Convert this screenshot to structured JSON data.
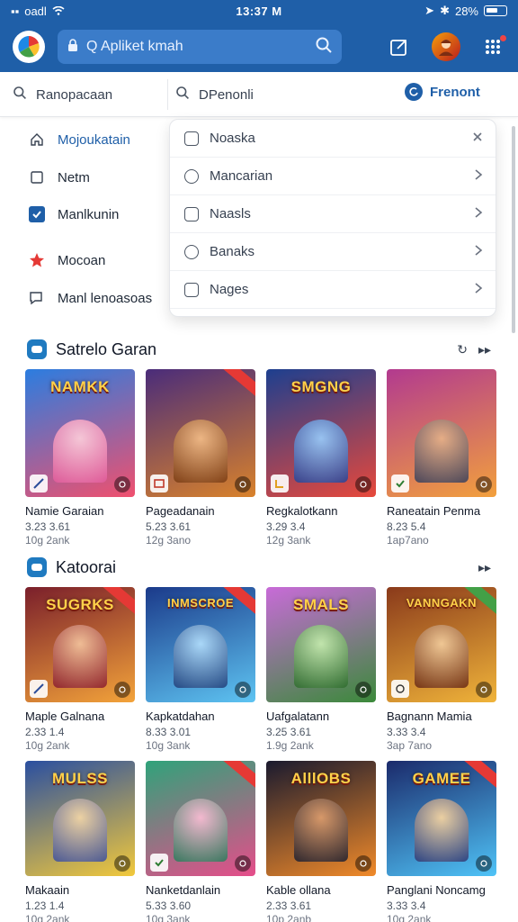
{
  "status": {
    "left_text": "oadl",
    "time": "13:37 M",
    "battery": "28%"
  },
  "appbar": {
    "search_text": "Q Apliket kmah"
  },
  "subbar": {
    "search1": "Ranopacaan",
    "search2": "DPenonli",
    "action": "Frenont"
  },
  "sidemenu": [
    {
      "label": "Mojoukatain",
      "icon": "home-icon",
      "active": true
    },
    {
      "label": "Netm",
      "icon": "bookmark-icon"
    },
    {
      "label": "Manlkunin",
      "icon": "checkbox-icon"
    },
    {
      "label": "Mocoan",
      "icon": "star-icon"
    },
    {
      "label": "Manl lenoasoas",
      "icon": "chat-icon"
    }
  ],
  "dropdown": [
    {
      "label": "Noaska",
      "trail": "close"
    },
    {
      "label": "Mancarian",
      "trail": "chevron"
    },
    {
      "label": "Naasls",
      "trail": "chevron"
    },
    {
      "label": "Banaks",
      "trail": "chevron"
    },
    {
      "label": "Nages",
      "trail": "chevron"
    }
  ],
  "sections": [
    {
      "title": "Satrelo Garan",
      "items": [
        {
          "cover": "NAMKK",
          "name": "Namie Garaian",
          "meta1": "3.23 3.61",
          "meta2": "10g 2ank",
          "colors": [
            "#2b7de0",
            "#f0506e"
          ]
        },
        {
          "cover": "",
          "name": "Pageadanain",
          "meta1": "5.23 3.61",
          "meta2": "12g 3ano",
          "colors": [
            "#4a2c7a",
            "#d9822b"
          ]
        },
        {
          "cover": "SMGNG",
          "name": "Regkalotkann",
          "meta1": "3.29 3.4",
          "meta2": "12g 3ank",
          "colors": [
            "#1d3f8f",
            "#e7483b"
          ]
        },
        {
          "cover": "",
          "name": "Raneatain Penma",
          "meta1": "8.23 5.4",
          "meta2": "1ap7ano",
          "colors": [
            "#b23a8f",
            "#f2a03d"
          ]
        }
      ]
    },
    {
      "title": "Katoorai",
      "items": [
        {
          "cover": "SUGRKS",
          "name": "Maple Galnana",
          "meta1": "2.33 1.4",
          "meta2": "10g 2ank",
          "colors": [
            "#7a1f2b",
            "#f3a33a"
          ]
        },
        {
          "cover": "INMSCROE",
          "name": "Kapkatdahan",
          "meta1": "8.33 3.01",
          "meta2": "10g 3ank",
          "colors": [
            "#1b3a8a",
            "#5ec4f2"
          ]
        },
        {
          "cover": "SMALS",
          "name": "Uafgalatann",
          "meta1": "3.25 3.61",
          "meta2": "1.9g 2ank",
          "colors": [
            "#3b8a3a",
            "#c86bd8"
          ]
        },
        {
          "cover": "VANNGAKN",
          "name": "Bagnann Mamia",
          "meta1": "3.33 3.4",
          "meta2": "3ap 7ano",
          "colors": [
            "#8a3a1b",
            "#f0b43a"
          ]
        }
      ]
    },
    {
      "title": "",
      "items": [
        {
          "cover": "MULSS",
          "name": "Makaain",
          "meta1": "1.23 1.4",
          "meta2": "10g 2ank",
          "colors": [
            "#2a4fa0",
            "#f2c93b"
          ]
        },
        {
          "cover": "",
          "name": "Nanketdanlain",
          "meta1": "5.33 3.60",
          "meta2": "10g 3ank",
          "colors": [
            "#2fa37a",
            "#e64d8a"
          ]
        },
        {
          "cover": "AlllOBS",
          "name": "Kable ollana",
          "meta1": "2.33 3.61",
          "meta2": "10p 2anb",
          "colors": [
            "#1a1a2e",
            "#f08a2a"
          ]
        },
        {
          "cover": "GAMEE",
          "name": "Panglani Noncamg",
          "meta1": "3.33 3.4",
          "meta2": "10g 2ank",
          "colors": [
            "#1b2a6b",
            "#4fc3f7"
          ]
        }
      ]
    }
  ]
}
